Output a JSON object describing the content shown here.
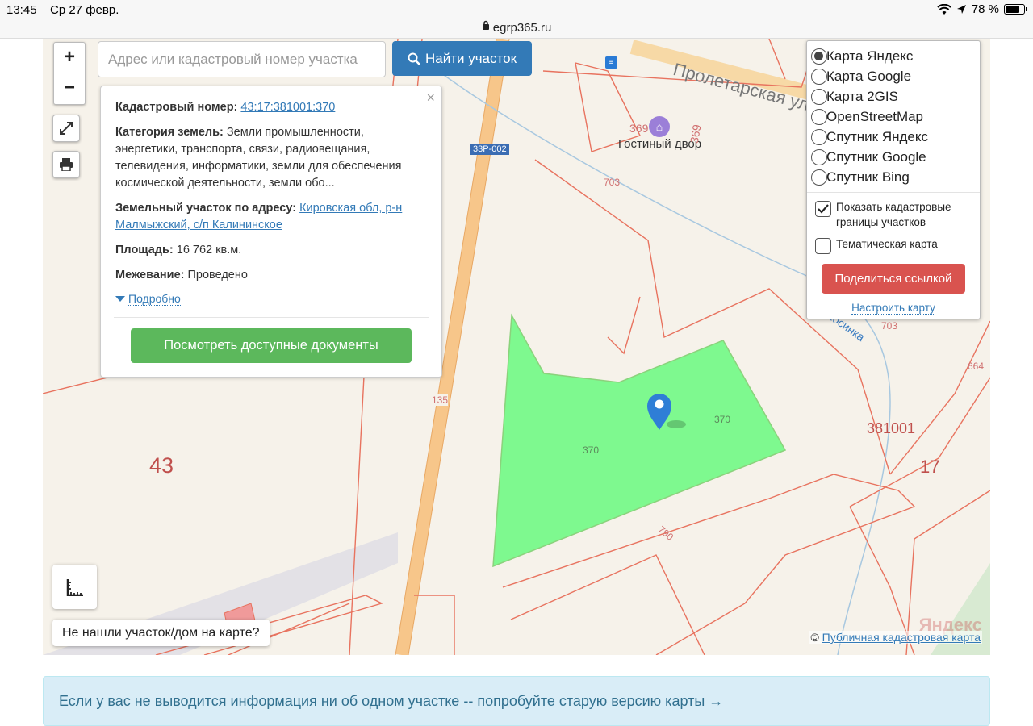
{
  "status_bar": {
    "time": "13:45",
    "date": "Ср 27 февр.",
    "battery": "78 %"
  },
  "browser": {
    "url": "egrp365.ru"
  },
  "map": {
    "search_placeholder": "Адрес или кадастровый номер участка",
    "find_button": "Найти участок",
    "zoom_in": "+",
    "zoom_out": "−",
    "labels": {
      "street": "Пролетарская ул",
      "hotel_name": "Гостиный двор",
      "road_code": "33Р-002",
      "river": "Хосинка",
      "quarter": "381001",
      "district_43": "43",
      "district_17": "17",
      "lot_369a": "369",
      "lot_369b": "369",
      "lot_703a": "703",
      "lot_703b": "703",
      "lot_664": "664",
      "lot_370a": "370",
      "lot_370b": "370",
      "lot_790": "790",
      "lot_135": "135"
    },
    "watermark": "Яндекс",
    "attribution_prefix": "©",
    "attribution_link": "Публичная кадастровая карта",
    "not_found_button": "Не нашли участок/дом на карте?"
  },
  "info_panel": {
    "close": "×",
    "cadastral_label": "Кадастровый номер:",
    "cadastral_value": "43:17:381001:370",
    "category_label": "Категория земель:",
    "category_value": "Земли промышленности, энергетики, транспорта, связи, радиовещания, телевидения, информатики, земли для обеспечения космической деятельности, земли обо...",
    "address_label": "Земельный участок по адресу:",
    "address_value": "Кировская обл, р-н Малмыжский, с/п Калининское",
    "area_label": "Площадь:",
    "area_value": "16 762 кв.м.",
    "survey_label": "Межевание:",
    "survey_value": "Проведено",
    "more_link": "Подробно",
    "docs_button": "Посмотреть доступные документы"
  },
  "layers_panel": {
    "options": [
      {
        "label": "Карта Яндекс",
        "selected": true
      },
      {
        "label": "Карта Google",
        "selected": false
      },
      {
        "label": "Карта 2GIS",
        "selected": false
      },
      {
        "label": "OpenStreetMap",
        "selected": false
      },
      {
        "label": "Спутник Яндекс",
        "selected": false
      },
      {
        "label": "Спутник Google",
        "selected": false
      },
      {
        "label": "Спутник Bing",
        "selected": false
      }
    ],
    "show_borders_label": "Показать кадастровые границы участков",
    "show_borders_checked": true,
    "thematic_label": "Тематическая карта",
    "thematic_checked": false,
    "share_button": "Поделиться ссылкой",
    "setup_link": "Настроить карту"
  },
  "alert": {
    "text": "Если у вас не выводится информация ни об одном участке --",
    "link": "попробуйте старую версию карты →"
  },
  "colors": {
    "primary": "#337ab7",
    "success": "#5cb85c",
    "danger": "#d9534f",
    "parcel_fill": "#7ef98f",
    "boundary": "#e8735f",
    "road": "#f5c47f"
  }
}
